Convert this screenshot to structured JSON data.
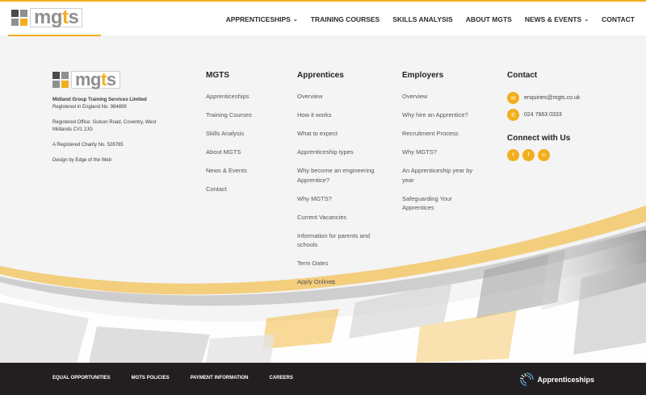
{
  "colors": {
    "accent": "#f2ae1c",
    "dark_bar": "#231f20",
    "logo_grey": "#8f8f8f",
    "logo_dark": "#4a4a4a"
  },
  "header": {
    "logo_text_pre": "mg",
    "logo_text_t": "t",
    "logo_text_post": "s",
    "nav": [
      {
        "label": "APPRENTICESHIPS",
        "has_dropdown": true
      },
      {
        "label": "TRAINING COURSES",
        "has_dropdown": false
      },
      {
        "label": "SKILLS ANALYSIS",
        "has_dropdown": false
      },
      {
        "label": "ABOUT MGTS",
        "has_dropdown": false
      },
      {
        "label": "NEWS & EVENTS",
        "has_dropdown": true
      },
      {
        "label": "CONTACT",
        "has_dropdown": false
      }
    ]
  },
  "brand": {
    "logo_text_pre": "mg",
    "logo_text_t": "t",
    "logo_text_post": "s",
    "org_name": "Midland Group Training Services Limited",
    "registered": "Registered in England No. 984899",
    "office": "Registered Office: Gulson Road, Coventry, West Midlands CV1 2JG",
    "charity": "A Registered Charity No. 528785",
    "design": "Design by Edge of the Web"
  },
  "columns": {
    "mgts": {
      "heading": "MGTS",
      "links": [
        "Apprenticeships",
        "Training Courses",
        "Skills Analysis",
        "About MGTS",
        "News & Events",
        "Contact"
      ]
    },
    "apprentices": {
      "heading": "Apprentices",
      "links": [
        "Overview",
        "How it works",
        "What to expect",
        "Apprenticeship types",
        "Why become an engineering Apprentice?",
        "Why MGTS?",
        "Current Vacancies",
        "Information for parents and schools",
        "Term Dates",
        "Apply Online"
      ]
    },
    "employers": {
      "heading": "Employers",
      "links": [
        "Overview",
        "Why hire an Apprentice?",
        "Recruitment Process",
        "Why MGTS?",
        "An Apprenticeship year by year",
        "Safeguarding Your Apprentices"
      ]
    }
  },
  "contact": {
    "heading": "Contact",
    "email": "enquiries@mgts.co.uk",
    "phone": "024 7663 0333",
    "connect_heading": "Connect with Us",
    "social": [
      {
        "icon": "twitter-icon",
        "glyph": "t"
      },
      {
        "icon": "facebook-icon",
        "glyph": "f"
      },
      {
        "icon": "linkedin-icon",
        "glyph": "in"
      }
    ]
  },
  "bottom": {
    "links": [
      "EQUAL OPPORTUNITIES",
      "MGTS POLICIES",
      "PAYMENT INFORMATION",
      "CAREERS"
    ],
    "apprenticeships_logo": "Apprenticeships"
  }
}
